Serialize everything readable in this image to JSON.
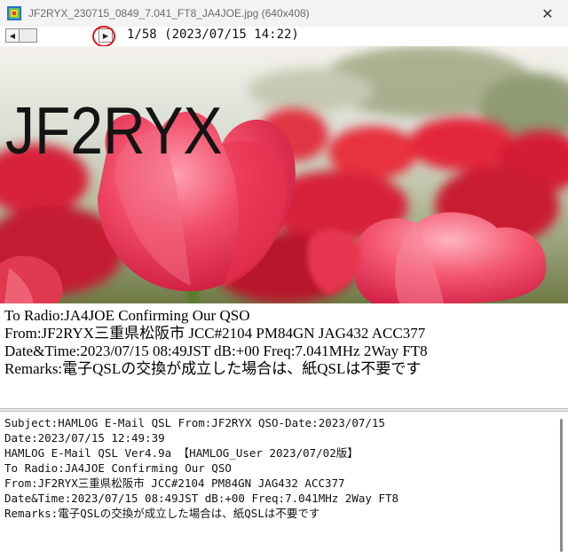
{
  "window": {
    "title": "JF2RYX_230715_0849_7.041_FT8_JA4JOE.jpg",
    "title_size": " (640x408)",
    "close_glyph": "✕"
  },
  "toolbar": {
    "prev_glyph": "◀",
    "next_glyph": "▶",
    "counter": "1/58 (2023/07/15 14:22)"
  },
  "card": {
    "callsign": "JF2RYX",
    "lines": [
      "To Radio:JA4JOE  Confirming Our QSO",
      "From:JF2RYX三重県松阪市  JCC#2104  PM84GN  JAG432  ACC377",
      "Date&Time:2023/07/15 08:49JST dB:+00 Freq:7.041MHz 2Way FT8",
      "Remarks:電子QSLの交換が成立した場合は、紙QSLは不要です"
    ]
  },
  "mail": {
    "lines": [
      "Subject:HAMLOG E-Mail QSL From:JF2RYX QSO-Date:2023/07/15",
      "Date:2023/07/15 12:49:39",
      "HAMLOG E-Mail QSL Ver4.9a  【HAMLOG_User 2023/07/02版】",
      "To Radio:JA4JOE  Confirming Our QSO",
      "From:JF2RYX三重県松阪市  JCC#2104  PM84GN  JAG432  ACC377",
      "Date&Time:2023/07/15 08:49JST dB:+00 Freq:7.041MHz 2Way FT8",
      "Remarks:電子QSLの交換が成立した場合は、紙QSLは不要です"
    ]
  },
  "colors": {
    "highlight_ring": "#e0121a",
    "tulip_red": "#e8213a"
  }
}
